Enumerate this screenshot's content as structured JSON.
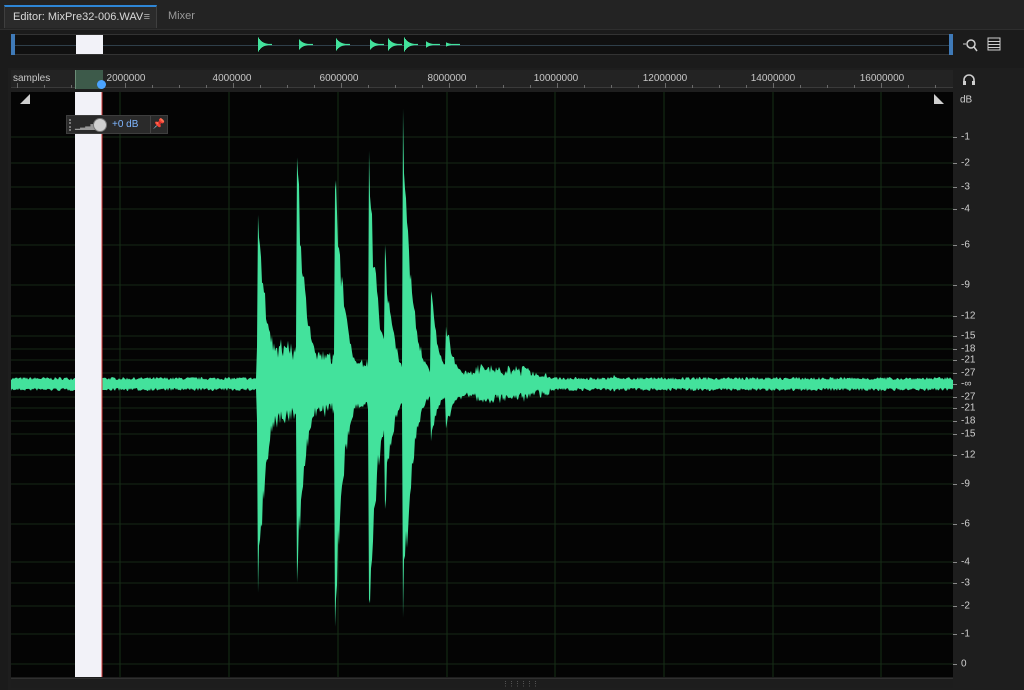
{
  "tabs": [
    {
      "label": "Editor: MixPre32-006.WAV",
      "active": true,
      "menu_glyph": "≡"
    },
    {
      "label": "Mixer",
      "active": false
    }
  ],
  "ruler": {
    "unit": "samples",
    "ticks": [
      "2000000",
      "4000000",
      "6000000",
      "8000000",
      "10000000",
      "12000000",
      "14000000",
      "16000000"
    ]
  },
  "hud": {
    "gain": "+0 dB"
  },
  "db_scale": {
    "unit": "dB",
    "labels": [
      "-1",
      "-2",
      "-3",
      "-4",
      "-6",
      "-9",
      "-12",
      "-15",
      "-18",
      "-21",
      "-27",
      "-∞",
      "-27",
      "-21",
      "-18",
      "-15",
      "-12",
      "-9",
      "-6",
      "-4",
      "-3",
      "-2",
      "-1",
      "0"
    ]
  },
  "colors": {
    "waveform": "#43e29c",
    "selection": "#f2f2f8",
    "playhead": "#4aa3ff",
    "accent": "#2e86d6"
  },
  "icons": [
    "zoom-icon",
    "list-icon",
    "headphones-icon",
    "pin-icon"
  ]
}
